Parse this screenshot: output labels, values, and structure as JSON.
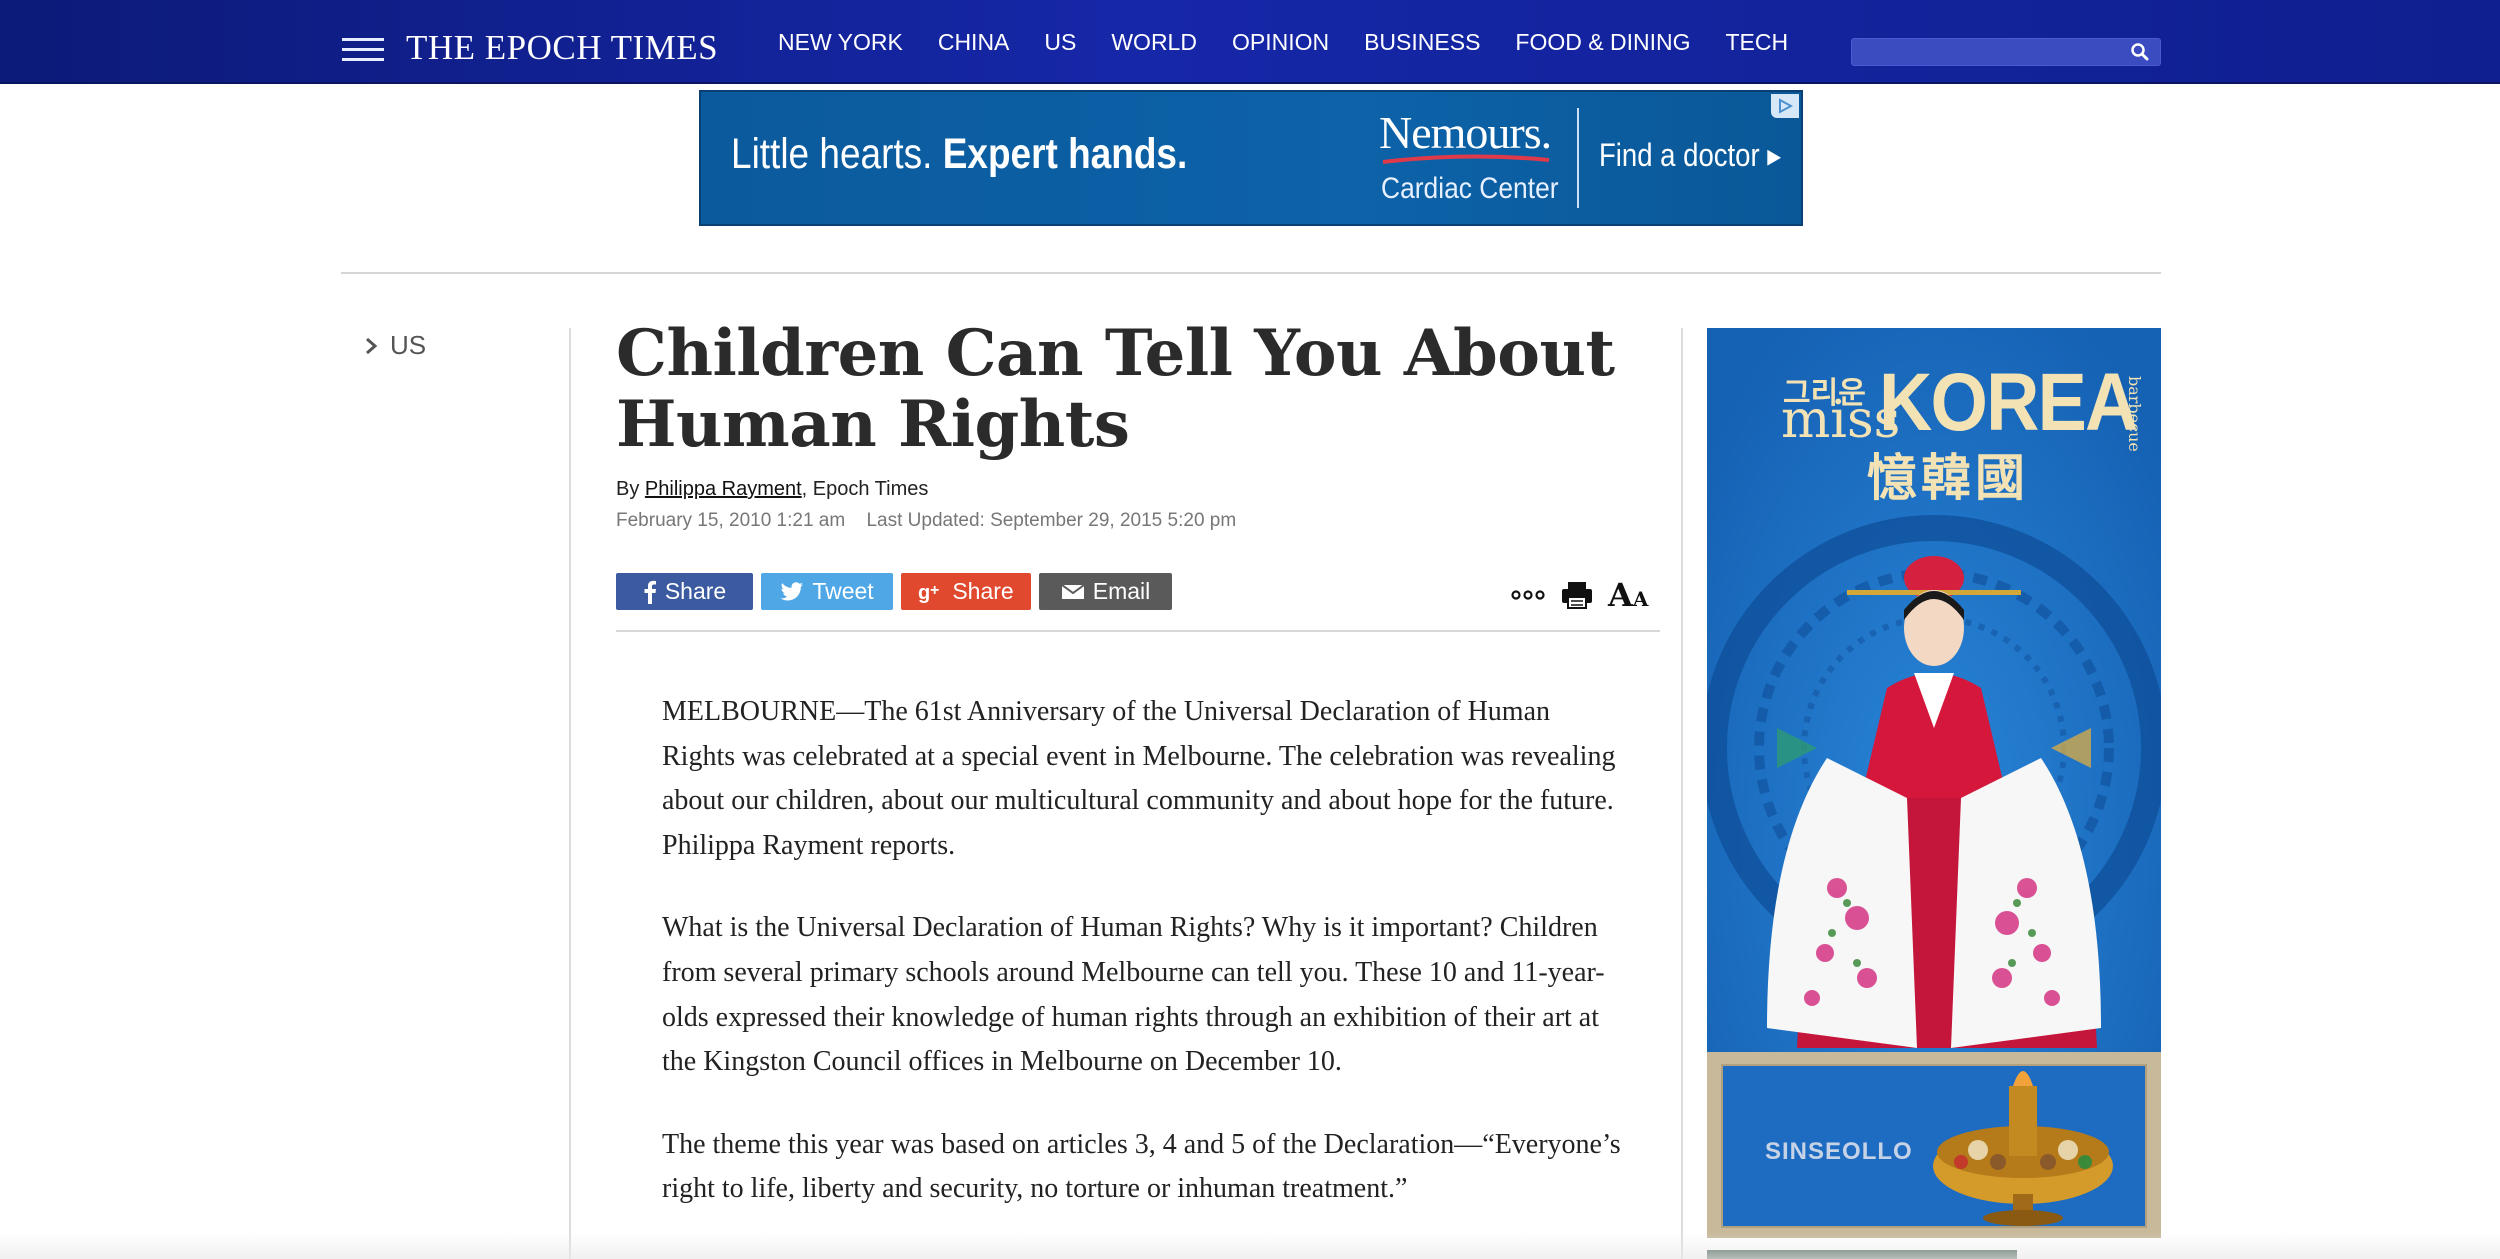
{
  "header": {
    "logo": "THE EPOCH TIMES",
    "nav": [
      "NEW YORK",
      "CHINA",
      "US",
      "WORLD",
      "OPINION",
      "BUSINESS",
      "FOOD & DINING",
      "TECH"
    ],
    "search": {
      "placeholder": "",
      "value": ""
    },
    "colors": {
      "bar": "#1627a8"
    }
  },
  "ad_top": {
    "tagline_light": "Little hearts. ",
    "tagline_bold": "Expert hands.",
    "brand": "Nemours.",
    "sub": "Cardiac Center",
    "cta": "Find a doctor ▸"
  },
  "breadcrumb": {
    "label": "US"
  },
  "article": {
    "title": "Children Can Tell You About Human Rights",
    "byline_prefix": "By ",
    "author": "Philippa Rayment",
    "byline_suffix": ", Epoch Times",
    "published": "February 15, 2010 1:21 am",
    "updated": "Last Updated: September 29, 2015 5:20 pm",
    "paragraphs": [
      "MELBOURNE—The 61st Anniversary of the Universal Declaration of Human Rights was celebrated at a special event in Melbourne. The celebration was revealing about our children, about our multicultural community and about hope for the future. Philippa Rayment reports.",
      "What is the Universal Declaration of Human Rights? Why is it important? Children from several primary schools around Melbourne can tell you. These 10 and 11-year-olds expressed their knowledge of human rights through an exhibition of their art at the Kingston Council offices in Melbourne on December 10.",
      "The theme this year was based on articles 3, 4 and 5 of the Declaration—“Everyone’s right to life, liberty and security, no torture or inhuman treatment.”"
    ]
  },
  "share": {
    "facebook": "Share",
    "twitter": "Tweet",
    "googleplus": "Share",
    "email": "Email",
    "colors": {
      "facebook": "#3b5aa0",
      "twitter": "#4fa7e6",
      "googleplus": "#e0492e",
      "email": "#5a5a5a"
    }
  },
  "tools": {
    "font_big": "A",
    "font_small": "A"
  },
  "ad_side": {
    "korean": "그리운",
    "miss": "miss",
    "korea": "KOREA",
    "bbq": "barbecue",
    "hanja": "憶韓國",
    "product": "SINSEOLLO"
  }
}
